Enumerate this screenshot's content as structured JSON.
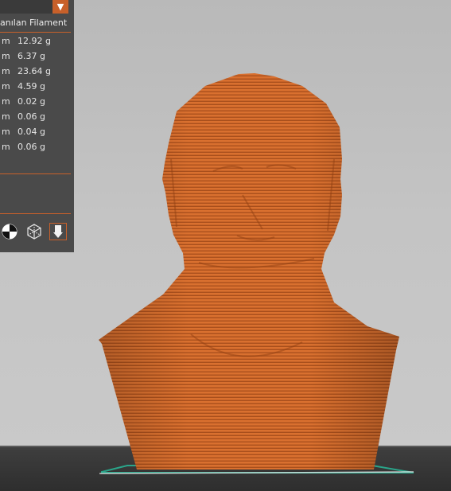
{
  "legend": {
    "dropdown_value": "",
    "column_header": "anılan Filament",
    "rows": [
      {
        "unit": "m",
        "weight": "12.92 g"
      },
      {
        "unit": "m",
        "weight": "6.37 g"
      },
      {
        "unit": "m",
        "weight": "23.64 g"
      },
      {
        "unit": "m",
        "weight": "4.59 g"
      },
      {
        "unit": "m",
        "weight": "0.02 g"
      },
      {
        "unit": "m",
        "weight": "0.06 g"
      },
      {
        "unit": "m",
        "weight": "0.04 g"
      },
      {
        "unit": "m",
        "weight": "0.06 g"
      }
    ]
  },
  "colors": {
    "accent": "#c8602a",
    "model": "#d9702f",
    "panel": "#4a4a4a",
    "background": "#c4c4c4",
    "floor": "#333333",
    "bed_outline": "#2aa58a"
  },
  "icons": [
    "center-of-mass-icon",
    "wireframe-cube-icon",
    "extruder-nozzle-icon"
  ]
}
